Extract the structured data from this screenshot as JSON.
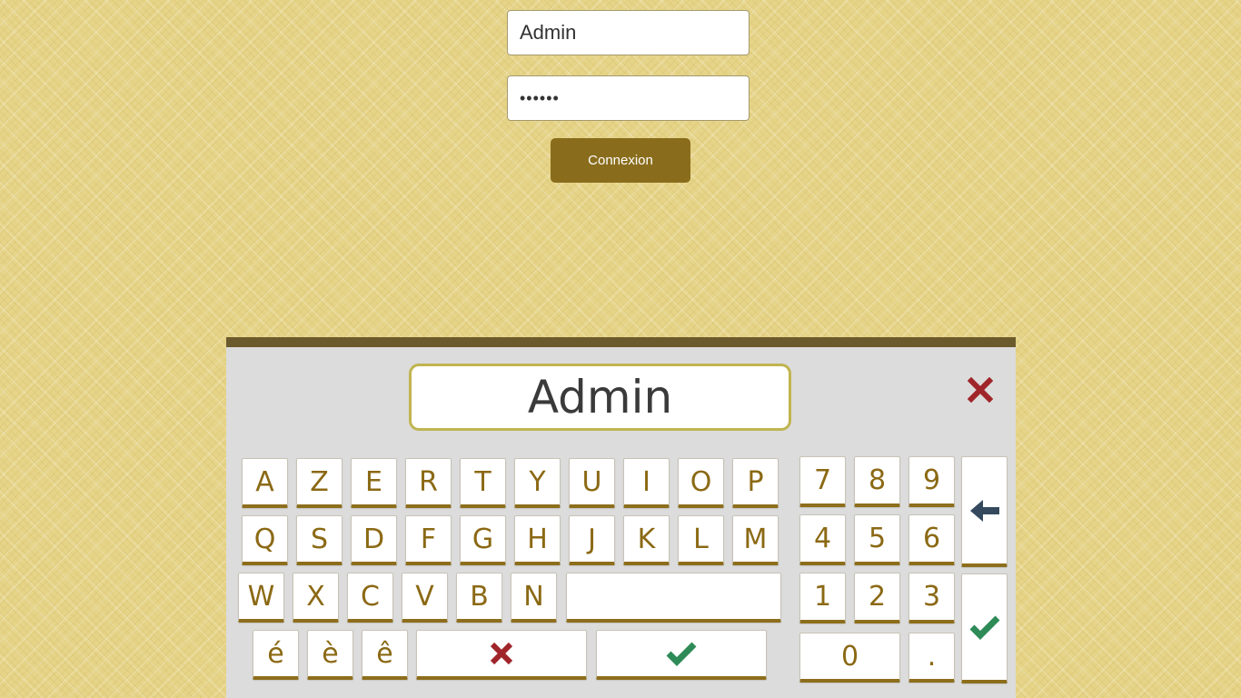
{
  "login": {
    "username_value": "Admin",
    "password_value": "••••••",
    "submit_label": "Connexion"
  },
  "keyboard": {
    "display_text": "Admin",
    "row1": [
      "A",
      "Z",
      "E",
      "R",
      "T",
      "Y",
      "U",
      "I",
      "O",
      "P"
    ],
    "row2": [
      "Q",
      "S",
      "D",
      "F",
      "G",
      "H",
      "J",
      "K",
      "L",
      "M"
    ],
    "row3": [
      "W",
      "X",
      "C",
      "V",
      "B",
      "N"
    ],
    "row4": [
      "é",
      "è",
      "ê"
    ],
    "numpad": {
      "r1": [
        "7",
        "8",
        "9"
      ],
      "r2": [
        "4",
        "5",
        "6"
      ],
      "r3": [
        "1",
        "2",
        "3"
      ],
      "zero": "0",
      "dot": "."
    },
    "icons": {
      "close": "close-x-icon",
      "cancel": "cancel-x-icon",
      "confirm": "checkmark-icon",
      "backspace": "backspace-arrow-icon",
      "enter": "checkmark-icon"
    },
    "colors": {
      "key_text": "#8b6914",
      "cancel_red": "#a0252a",
      "confirm_green": "#2e8b57",
      "backspace_dark": "#34495e"
    }
  }
}
